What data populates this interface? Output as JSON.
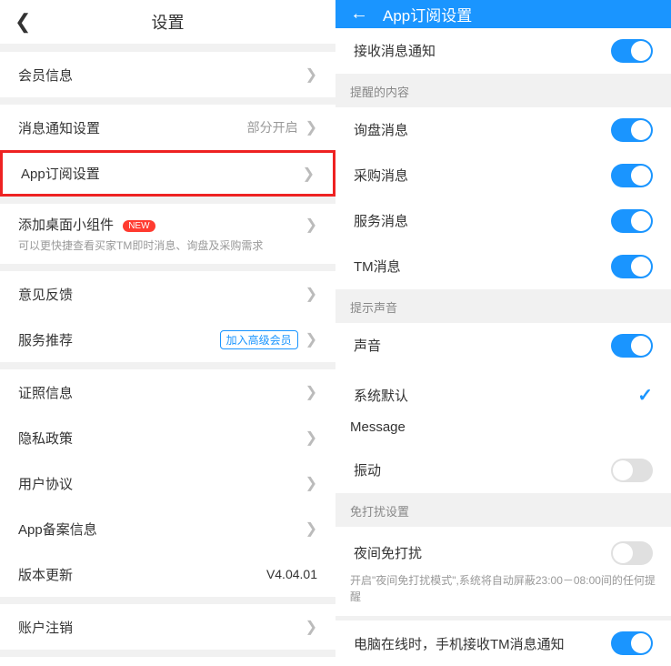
{
  "left": {
    "title": "设置",
    "items": {
      "member": "会员信息",
      "notify": "消息通知设置",
      "notify_status": "部分开启",
      "subscribe": "App订阅设置",
      "widget": "添加桌面小组件",
      "widget_badge": "NEW",
      "widget_sub": "可以更快捷查看买家TM即时消息、询盘及采购需求",
      "feedback": "意见反馈",
      "recommend": "服务推荐",
      "recommend_badge": "加入高级会员",
      "license": "证照信息",
      "privacy": "隐私政策",
      "agreement": "用户协议",
      "record": "App备案信息",
      "version": "版本更新",
      "version_val": "V4.04.01",
      "logout": "账户注销"
    }
  },
  "right": {
    "title": "App订阅设置",
    "receive": "接收消息通知",
    "section_remind": "提醒的内容",
    "inquiry": "询盘消息",
    "purchase": "采购消息",
    "service": "服务消息",
    "tm": "TM消息",
    "section_sound": "提示声音",
    "sound": "声音",
    "default": "系统默认",
    "message": "Message",
    "vibrate": "振动",
    "section_dnd": "免打扰设置",
    "night": "夜间免打扰",
    "night_sub": "开启\"夜间免打扰模式\",系统将自动屏蔽23:00－08:00间的任何提醒",
    "pc_online": "电脑在线时，手机接收TM消息通知"
  }
}
